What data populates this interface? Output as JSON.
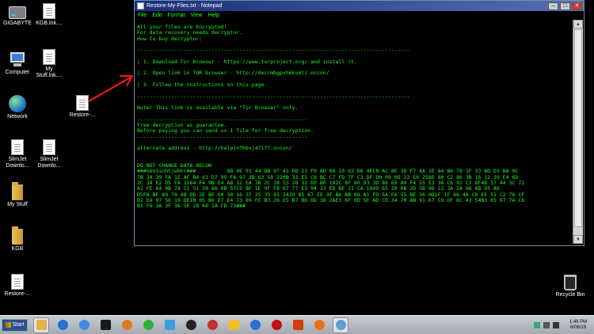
{
  "desktop": {
    "icons": [
      {
        "label": "GIGABYTE",
        "icon": "drive-icon"
      },
      {
        "label": "KGB.lnk....",
        "icon": "document-icon"
      },
      {
        "label": "Computer",
        "icon": "computer-icon"
      },
      {
        "label": "My Stuff.lnk....",
        "icon": "document-icon"
      },
      {
        "label": "Network",
        "icon": "network-globe-icon"
      },
      {
        "label": "Restore-...",
        "icon": "document-icon"
      },
      {
        "label": "SlimJet Downlo...",
        "icon": "document-icon"
      },
      {
        "label": "SlimJet Downlo...",
        "icon": "document-icon"
      },
      {
        "label": "My Stuff",
        "icon": "folder-icon"
      },
      {
        "label": "KGB",
        "icon": "folder-icon"
      },
      {
        "label": "Restore-...",
        "icon": "document-icon"
      },
      {
        "label": "Recycle Bin",
        "icon": "recycle-bin-icon"
      }
    ]
  },
  "notepad": {
    "title": "Restore-My-Files.txt - Notepad",
    "menu": [
      "File",
      "Edit",
      "Format",
      "View",
      "Help"
    ],
    "lines": [
      "All your files are Encrypted!",
      "For data recovery needs decryptor.",
      "How to buy decryptor:",
      "",
      "----------------------------------------------------------------------------------------",
      "",
      "| 1. Download Tor browser - https://www.torproject.org/ and install it.",
      "",
      "| 2. Open link in TOR browser - http://decrmbgpvh6kvmti.onion/",
      "",
      "| 3. Follow the instructions on this page",
      "",
      "----------------------------------------------------------------------------------------",
      "",
      "Note! This link is available via \"Tor Browser\" only.",
      "",
      "-------------------------------------------------------",
      "Free decryption as guarantee.",
      "Before paying you can send us 1 file for free decryption.",
      "-------------------------------------------------------",
      "",
      "alternate address - http://helpinfh6vj47ift.onion/",
      "",
      "",
      "DO NOT CHANGE DATA BELOW",
      "###%6U1snhtjwbhr###          8B 9E 91 44 DB 97 41 DD 21 FD AD 86 10 62 D6 4EC8 AC 8E 38 F7 4A 1E A4 B6 78 1F 33 BD D3 B8 0C",
      "7B 24 39 FA 1E AF B4 61 D7 99 FA 97 3B 63 58 220B 33 E5 C8 BC C7 FD 7F C3 DF D0 09 0D 22 E0 258D 80 C2 86 3B 16 12 39 E4 6D",
      "2C 34 E2 D5 FA 1564 F4 9B E4 A8 12 EA 7B 2C 38 53 28 32 D0 B0 182C 8F 80 93 3D 86 69 A0 F4 55 E3 3A C6 92 C2 8F4B 57 44 3C 72",
      "A1 FE 64 0B 78 C1 51 28 66 0B 57C5 BF 1E 9F F8 D7 77 E3 94 13 ED BE 21 CA 1949 65 20 0B 2D 5B 96 12 3A 2A 06 8B 05 A6",
      "D5FB BE 89 70 6B DD 2E BE 60 30 16 37 25 35 85 3439 85 67 EE 3F BA AB 88 A1 FD 5A E6 55 BE 36 0D2F 1F 86 4A C0 EE 51 C2 76 CF",
      "D2 EA 97 56 19 DE1B 05 B6 D7 E4 73 89 FE B3 26 E5 B7 BD DD 38 2AE3 6F 0D 5E AD CD 34 70 AB 91 67 C6 DF 6C 42 54B1 65 67 7A C6",
      "B3 F6 3A 3F 36 5E 28 60 1A FD 73###"
    ]
  },
  "taskbar": {
    "start_label": "Start",
    "pinned": [
      "file-explorer-icon",
      "media-player-icon",
      "browser-globe-icon",
      "network-monitor-icon",
      "search-magnifier-icon",
      "torrent-icon",
      "downloader-icon",
      "cleaner-icon",
      "archiver-icon",
      "disc-icon",
      "vpn-icon",
      "record-icon",
      "ccleaner-icon",
      "firefox-icon",
      "notepad-icon"
    ],
    "clock_time": "1:49 PM",
    "clock_date": "6/06/19"
  },
  "colors": {
    "terminal_green": "#19ff19",
    "arrow": "#e81818",
    "titlebar": "#1a2e7a"
  }
}
